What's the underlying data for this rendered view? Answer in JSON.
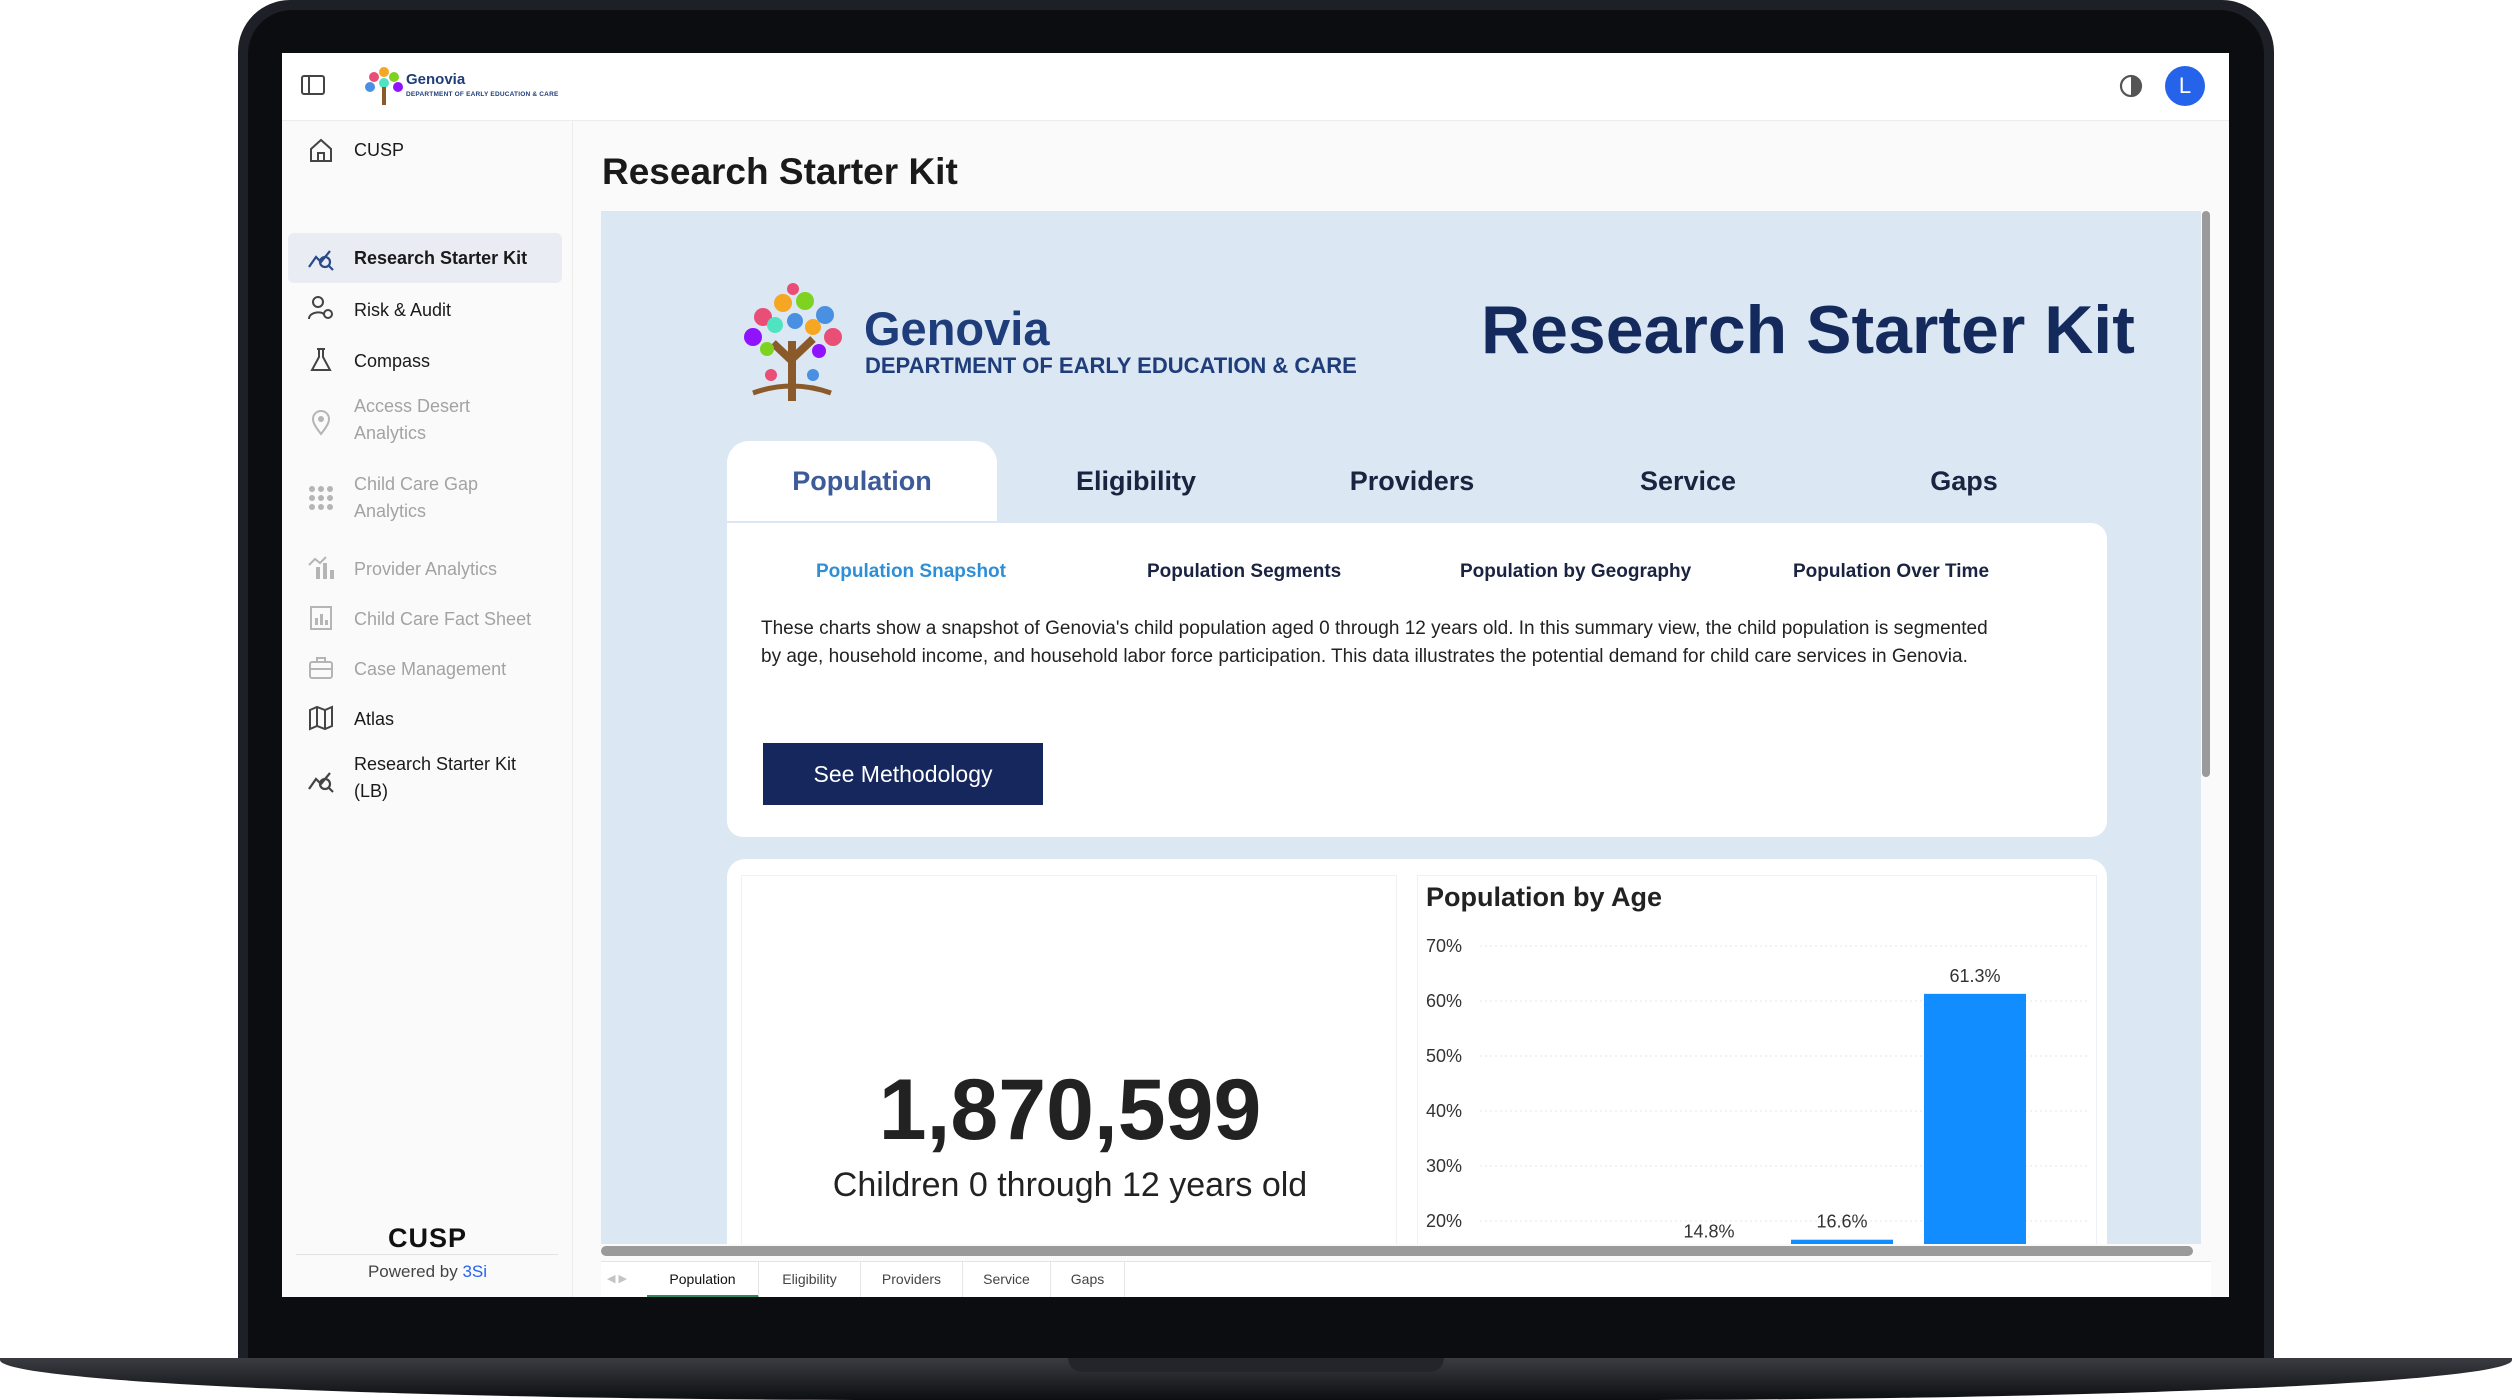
{
  "app": {
    "brand": "Genovia",
    "brand_sub": "DEPARTMENT OF EARLY EDUCATION & CARE",
    "avatar_initial": "L"
  },
  "sidebar": {
    "items": [
      {
        "label": "CUSP",
        "icon": "home-icon",
        "state": "enabled"
      },
      {
        "label": "Research Starter Kit",
        "icon": "chart-search-icon",
        "state": "active"
      },
      {
        "label": "Risk & Audit",
        "icon": "user-audit-icon",
        "state": "enabled"
      },
      {
        "label": "Compass",
        "icon": "flask-icon",
        "state": "enabled"
      },
      {
        "label": "Access Desert Analytics",
        "icon": "map-pin-icon",
        "state": "disabled"
      },
      {
        "label": "Child Care Gap Analytics",
        "icon": "grid-dots-icon",
        "state": "disabled"
      },
      {
        "label": "Provider Analytics",
        "icon": "provider-chart-icon",
        "state": "disabled"
      },
      {
        "label": "Child Care Fact Sheet",
        "icon": "fact-sheet-icon",
        "state": "disabled"
      },
      {
        "label": "Case Management",
        "icon": "briefcase-icon",
        "state": "disabled"
      },
      {
        "label": "Atlas",
        "icon": "map-icon",
        "state": "enabled"
      },
      {
        "label": "Research Starter Kit (LB)",
        "icon": "chart-search-icon",
        "state": "enabled"
      }
    ],
    "footer_logo": "CUSP",
    "powered_prefix": "Powered by",
    "powered_brand": "3Si"
  },
  "page": {
    "title": "Research Starter Kit"
  },
  "report": {
    "brand": "Genovia",
    "brand_sub": "DEPARTMENT OF EARLY EDUCATION & CARE",
    "title": "Research Starter Kit",
    "tabs": [
      "Population",
      "Eligibility",
      "Providers",
      "Service",
      "Gaps"
    ],
    "active_tab": "Population",
    "subtabs": [
      "Population Snapshot",
      "Population Segments",
      "Population by Geography",
      "Population Over Time"
    ],
    "active_subtab": "Population Snapshot",
    "description_line1": "These charts show a snapshot of Genovia's child population aged 0 through 12 years old. In this summary view, the child population is segmented",
    "description_line2": "by age, household income, and household labor force participation. This data illustrates the potential demand for child care services in Genovia.",
    "methodology_button": "See Methodology",
    "kpi_value": "1,870,599",
    "kpi_label": "Children 0 through 12 years old"
  },
  "chart_data": {
    "type": "bar",
    "title": "Population by Age",
    "categories": [
      "",
      "",
      ""
    ],
    "values": [
      14.8,
      16.6,
      61.3
    ],
    "value_labels": [
      "14.8%",
      "16.6%",
      "61.3%"
    ],
    "y_ticks": [
      "70%",
      "60%",
      "50%",
      "40%",
      "30%",
      "20%"
    ],
    "ylim": [
      20,
      70
    ],
    "grid": true,
    "bar_color": "#118dff"
  },
  "page_tabs": [
    "Population",
    "Eligibility",
    "Providers",
    "Service",
    "Gaps"
  ],
  "colors": {
    "accent": "#2563eb",
    "navy": "#15275c",
    "report_bg": "#dbe8f3",
    "active_subtab": "#2f8fd6"
  }
}
